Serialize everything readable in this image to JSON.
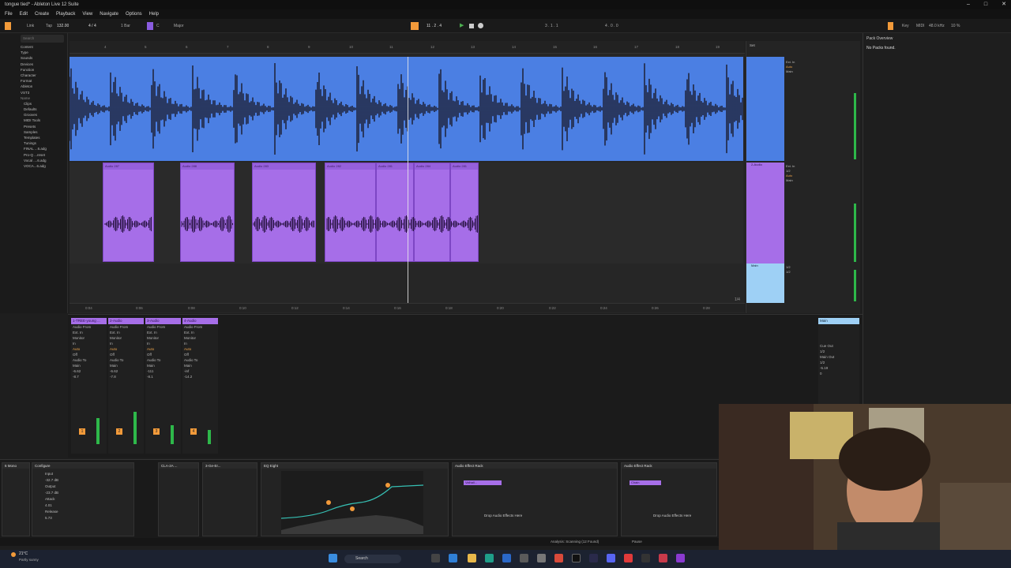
{
  "window": {
    "title": "tongue tied* - Ableton Live 12 Suite"
  },
  "menu": [
    "File",
    "Edit",
    "Create",
    "Playback",
    "View",
    "Navigate",
    "Options",
    "Help"
  ],
  "transport": {
    "link": "Link",
    "tap": "Tap",
    "tempo": "132.00",
    "signature": "4 / 4",
    "quantize": "1 Bar",
    "scale_key": "C",
    "scale_mode": "Major",
    "position": "11 . 2 . 4",
    "loop_start": "3 . 1 . 1",
    "loop_len": "4 . 0 . 0",
    "key_label": "Key",
    "midi_label": "MIDI",
    "sample_rate": "48.0 kHz",
    "cpu": "10 %",
    "colors": {
      "accent": "#f29a3a",
      "play": "#4caf50"
    }
  },
  "browser": {
    "search_placeholder": "Search",
    "sections": [
      "Content",
      "Type",
      "Sounds",
      "Devices",
      "Function",
      "Character",
      "Format",
      "Ableton",
      "VST3"
    ],
    "list_header": "Name",
    "items": [
      "Clips",
      "Defaults",
      "Grooves",
      "MIDI Tools",
      "Presets",
      "Samples",
      "Templates",
      "Tunings",
      "FINAL ...6.adg",
      "Pro-Q ...reset",
      "Vocal ....6.adg",
      "VOCA...6.adg"
    ]
  },
  "ruler": {
    "bars": [
      "4",
      "5",
      "6",
      "7",
      "8",
      "9",
      "10",
      "11",
      "12",
      "13",
      "14",
      "15",
      "16",
      "17",
      "18",
      "19"
    ],
    "set_label": "Set"
  },
  "timeline_bottom": [
    "0:04",
    "0:06",
    "0:08",
    "0:10",
    "0:12",
    "0:14",
    "0:16",
    "0:18",
    "0:20",
    "0:22",
    "0:24",
    "0:26",
    "0:28"
  ],
  "grid_label": "1/4",
  "tracks": [
    {
      "name": "1-Audio",
      "color": "#4b7fe3",
      "io": "Ext. In",
      "in": "1/2",
      "out": "Main",
      "monitor": "Auto"
    },
    {
      "name": "2-Audio",
      "color": "#a66ee8",
      "io": "Ext. In",
      "in": "1/2",
      "out": "Main",
      "monitor": "Auto"
    },
    {
      "name": "Main",
      "color": "#9ed0f5",
      "io": "1/2",
      "out": "1/2"
    }
  ],
  "clips": [
    {
      "label": "Audio 287"
    },
    {
      "label": "Audio 288"
    },
    {
      "label": "Audio 283"
    },
    {
      "label": "Audio 282"
    },
    {
      "label": "Audio 281"
    },
    {
      "label": "Audio 284"
    },
    {
      "label": "Audio 281"
    }
  ],
  "mixer": {
    "strips": [
      {
        "title": "1-TREE-young ...",
        "num": "1",
        "vol": "-6.62",
        "peak": "-8.7",
        "level": 0.55
      },
      {
        "title": "2-Audio",
        "num": "2",
        "vol": "-6.62",
        "peak": "-7.8",
        "level": 0.68
      },
      {
        "title": "3-Audio",
        "num": "3",
        "vol": "-111",
        "peak": "-8.1",
        "level": 0.4
      },
      {
        "title": "4-Audio",
        "num": "4",
        "vol": "-inf",
        "peak": "-14.2",
        "level": 0.3
      }
    ],
    "strip_labels": {
      "audio_from": "Audio From",
      "ext_in": "Ext. In",
      "monitor": "Monitor",
      "in": "In",
      "auto": "Auto",
      "off": "Off",
      "audio_to": "Audio To",
      "main": "Main"
    },
    "main": {
      "title": "Main",
      "cue_out": "Cue Out",
      "cue_val": "1/2",
      "main_out": "Main Out",
      "main_val": "1/2",
      "vol": "-5.19",
      "pan": "0"
    }
  },
  "devices": [
    {
      "title": "6 Mono"
    },
    {
      "title": "Configure",
      "params": [
        "Input",
        "-32.7 dB",
        "Output",
        "-23.7 dB",
        "Attack",
        "4.01",
        "Release",
        "5.73"
      ]
    },
    {
      "title": "CLA-2A ..."
    },
    {
      "title": "3-Ge-Er..."
    },
    {
      "title": "EQ Eight"
    },
    {
      "title": "Audio Effect Rack",
      "chain": "Valhall...",
      "drop": "Drop Audio Effects Here"
    },
    {
      "title": "Audio Effect Rack",
      "chain": "Chain",
      "drop": "Drop Audio Effects Here"
    }
  ],
  "pack_panel": {
    "title": "Pack Overview",
    "message": "No Packs found."
  },
  "status": {
    "text": "Analysis: Scanning (12 Found)",
    "pause": "Pause"
  },
  "taskbar": {
    "weather_temp": "21°C",
    "weather_desc": "Partly sunny",
    "search": "Search"
  }
}
